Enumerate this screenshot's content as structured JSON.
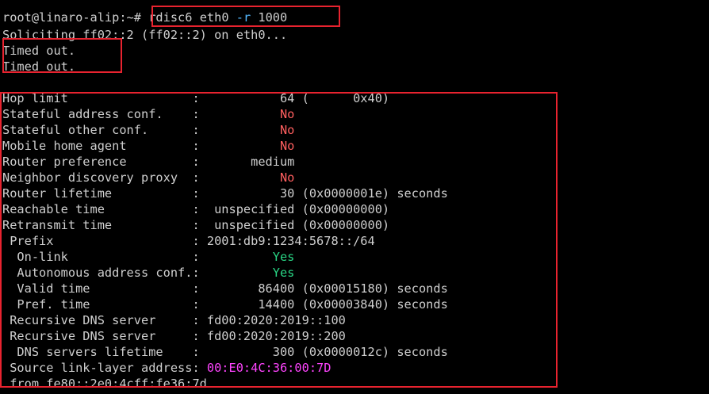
{
  "prompt": "root@linaro-alip:~#",
  "command": {
    "name": "rdisc6",
    "iface": "eth0",
    "option": "-r",
    "value": "1000"
  },
  "soliciting": "Soliciting ff02::2 (ff02::2) on eth0...",
  "timeouts": [
    "Timed out.",
    "Timed out."
  ],
  "rows": [
    {
      "label": "Hop limit                 :",
      "value": "           64 (      0x40)",
      "color": ""
    },
    {
      "label": "Stateful address conf.    :",
      "value": "           No",
      "color": "#ff5f5f"
    },
    {
      "label": "Stateful other conf.      :",
      "value": "           No",
      "color": "#ff5f5f"
    },
    {
      "label": "Mobile home agent         :",
      "value": "           No",
      "color": "#ff5f5f"
    },
    {
      "label": "Router preference         :",
      "value": "       medium",
      "color": ""
    },
    {
      "label": "Neighbor discovery proxy  :",
      "value": "           No",
      "color": "#ff5f5f"
    },
    {
      "label": "Router lifetime           :",
      "value": "           30 (0x0000001e) seconds",
      "color": ""
    },
    {
      "label": "Reachable time            :",
      "value": "  unspecified (0x00000000)",
      "color": ""
    },
    {
      "label": "Retransmit time           :",
      "value": "  unspecified (0x00000000)",
      "color": ""
    },
    {
      "label": " Prefix                   :",
      "value": " 2001:db9:1234:5678::/64",
      "color": ""
    },
    {
      "label": "  On-link                 :",
      "value": "          Yes",
      "color": "#29d685"
    },
    {
      "label": "  Autonomous address conf.:",
      "value": "          Yes",
      "color": "#29d685"
    },
    {
      "label": "  Valid time              :",
      "value": "        86400 (0x00015180) seconds",
      "color": ""
    },
    {
      "label": "  Pref. time              :",
      "value": "        14400 (0x00003840) seconds",
      "color": ""
    },
    {
      "label": " Recursive DNS server     :",
      "value": " fd00:2020:2019::100",
      "color": ""
    },
    {
      "label": " Recursive DNS server     :",
      "value": " fd00:2020:2019::200",
      "color": ""
    },
    {
      "label": "  DNS servers lifetime    :",
      "value": "          300 (0x0000012c) seconds",
      "color": ""
    },
    {
      "label": " Source link-layer address:",
      "value": " 00:E0:4C:36:00:7D",
      "color": "#ff44ff"
    },
    {
      "label": " from fe80::2e0:4cff:fe36:7d",
      "value": "",
      "color": ""
    }
  ],
  "colors": {
    "background": "#000000",
    "text": "#cfcfcf",
    "no": "#ff5f5f",
    "yes": "#29d685",
    "mac": "#ff44ff",
    "option": "#54b9ff",
    "highlight_box": "#e8232f"
  }
}
